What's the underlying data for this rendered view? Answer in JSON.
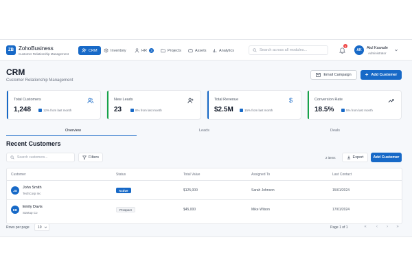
{
  "brand": {
    "logo": "ZB",
    "name": "ZohoBusiness",
    "subtitle": "Customer Relationship Management"
  },
  "nav": [
    {
      "label": "CRM",
      "icon": "people-icon",
      "active": true
    },
    {
      "label": "Inventory",
      "icon": "box-icon"
    },
    {
      "label": "HR",
      "icon": "person-icon",
      "badge": "3"
    },
    {
      "label": "Projects",
      "icon": "folder-icon"
    },
    {
      "label": "Assets",
      "icon": "briefcase-icon"
    },
    {
      "label": "Analytics",
      "icon": "bar-chart-icon"
    }
  ],
  "search": {
    "placeholder": "Search across all modules..."
  },
  "notifications": {
    "count": "5"
  },
  "user": {
    "initials": "AK",
    "name": "Atul Kawade",
    "role": "Administrator"
  },
  "page": {
    "title": "CRM",
    "subtitle": "Customer Relationship Management",
    "email_campaign": "Email Campaign",
    "add_customer": "Add Customer"
  },
  "stats": [
    {
      "label": "Total Customers",
      "value": "1,248",
      "change": "12% from last month",
      "color": "#1769c7",
      "icon": "users-icon"
    },
    {
      "label": "New Leads",
      "value": "23",
      "change": "8% from last month",
      "color": "#16a34a",
      "icon": "user-plus-icon"
    },
    {
      "label": "Total Revenue",
      "value": "$2.5M",
      "change": "15% from last month",
      "color": "#1769c7",
      "icon": "dollar-icon"
    },
    {
      "label": "Conversion Rate",
      "value": "18.5%",
      "change": "5% from last month",
      "color": "#16a34a",
      "icon": "trend-up-icon"
    }
  ],
  "tabs": [
    "Overview",
    "Leads",
    "Deals"
  ],
  "recent": {
    "title": "Recent Customers",
    "search_placeholder": "Search customers...",
    "filters": "Filters",
    "count": "2 items",
    "export": "Export",
    "add_customer": "Add Customer"
  },
  "table": {
    "columns": [
      "Customer",
      "Status",
      "Total Value",
      "Assigned To",
      "Last Contact"
    ],
    "rows": [
      {
        "initials": "JS",
        "name": "John Smith",
        "company": "TechCorp Inc",
        "status": "Active",
        "value": "$125,000",
        "assigned": "Sarah Johnson",
        "last_contact": "15/01/2024"
      },
      {
        "initials": "ED",
        "name": "Emily Davis",
        "company": "Startup Co",
        "status": "Prospect",
        "value": "$45,000",
        "assigned": "Mike Wilson",
        "last_contact": "17/01/2024"
      }
    ]
  },
  "pagination": {
    "rows_label": "Rows per page",
    "rows_value": "10",
    "page_info": "Page 1 of 1"
  }
}
